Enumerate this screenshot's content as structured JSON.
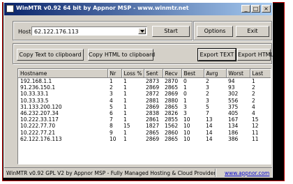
{
  "window": {
    "title": "WinMTR v0.92 64 bit by Appnor MSP - www.winmtr.net",
    "controls": [
      "_",
      "□",
      "×"
    ]
  },
  "host": {
    "label": "Host:",
    "value": "62.122.176.113"
  },
  "buttons": {
    "start": "Start",
    "options": "Options",
    "exit": "Exit",
    "copy_text": "Copy Text to clipboard",
    "copy_html": "Copy HTML to clipboard",
    "export_text": "Export TEXT",
    "export_html": "Export HTML"
  },
  "table": {
    "columns": [
      "Hostname",
      "Nr",
      "Loss %",
      "Sent",
      "Recv",
      "Best",
      "Avrg",
      "Worst",
      "Last"
    ],
    "rows": [
      [
        "192.168.1.1",
        "1",
        "1",
        "2873",
        "2870",
        "0",
        "2",
        "94",
        "1"
      ],
      [
        "91.236.150.1",
        "2",
        "1",
        "2869",
        "2865",
        "1",
        "3",
        "93",
        "2"
      ],
      [
        "10.33.33.1",
        "3",
        "1",
        "2872",
        "2869",
        "0",
        "2",
        "302",
        "2"
      ],
      [
        "10.33.33.5",
        "4",
        "1",
        "2881",
        "2880",
        "1",
        "3",
        "556",
        "2"
      ],
      [
        "31.133.200.120",
        "5",
        "1",
        "2869",
        "2865",
        "3",
        "5",
        "375",
        "4"
      ],
      [
        "46.232.207.34",
        "6",
        "1",
        "2838",
        "2826",
        "3",
        "7",
        "405",
        "4"
      ],
      [
        "10.222.33.117",
        "7",
        "1",
        "2861",
        "2855",
        "10",
        "13",
        "167",
        "15"
      ],
      [
        "10.222.77.70",
        "8",
        "15",
        "1827",
        "1562",
        "10",
        "14",
        "134",
        "12"
      ],
      [
        "10.222.77.21",
        "9",
        "1",
        "2865",
        "2860",
        "10",
        "14",
        "186",
        "11"
      ],
      [
        "62.122.176.113",
        "10",
        "1",
        "2869",
        "2865",
        "10",
        "14",
        "386",
        "11"
      ]
    ]
  },
  "status": {
    "text": "WinMTR v0.92 GPL V2 by Appnor MSP - Fully Managed Hosting & Cloud Provider",
    "link": "www.appnor.com"
  },
  "colors": {
    "title_start": "#0a246a",
    "title_end": "#a6caf0",
    "face": "#d4d0c8",
    "link": "#0000cc"
  }
}
